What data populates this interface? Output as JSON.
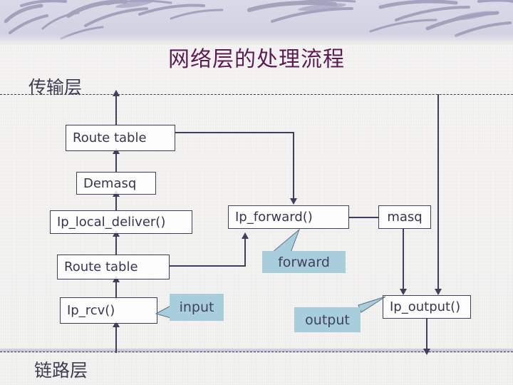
{
  "slide": {
    "title": "网络层的处理流程",
    "title_color": "#5b1b53",
    "background_color": "#f4f3f1",
    "banner_color": "#d4d4e4",
    "box_border_color": "#3f3f5c",
    "box_text_color": "#363651",
    "callout_fill_color": "#a9cedb",
    "connector_color": "#3f3f5c",
    "boundary_line_color": "#3a3a55"
  },
  "layers": {
    "transport": {
      "label": "传输层"
    },
    "link": {
      "label": "链路层"
    }
  },
  "nodes": {
    "route_table_top": {
      "label": "Route table"
    },
    "demasq": {
      "label": "Demasq"
    },
    "ip_local_deliver": {
      "label": "Ip_local_deliver()"
    },
    "route_table_bottom": {
      "label": "Route table"
    },
    "ip_rcv": {
      "label": "Ip_rcv()"
    },
    "ip_forward": {
      "label": "Ip_forward()"
    },
    "masq": {
      "label": "masq"
    },
    "ip_output": {
      "label": "Ip_output()"
    }
  },
  "callouts": {
    "forward": {
      "label": "forward"
    },
    "input": {
      "label": "input"
    },
    "output": {
      "label": "output"
    }
  }
}
